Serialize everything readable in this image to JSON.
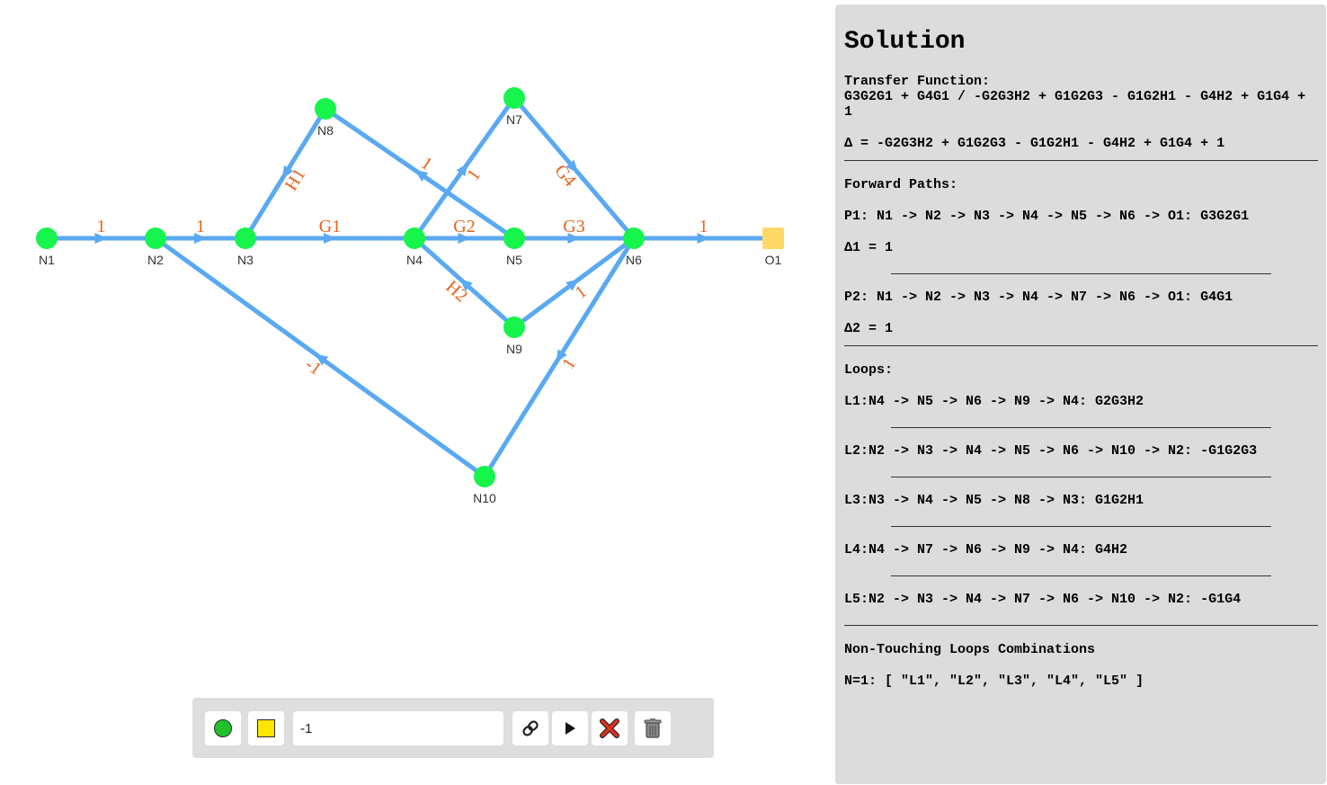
{
  "graph": {
    "nodes": [
      {
        "id": "N1",
        "label": "N1"
      },
      {
        "id": "N2",
        "label": "N2"
      },
      {
        "id": "N3",
        "label": "N3"
      },
      {
        "id": "N4",
        "label": "N4"
      },
      {
        "id": "N5",
        "label": "N5"
      },
      {
        "id": "N6",
        "label": "N6"
      },
      {
        "id": "N7",
        "label": "N7"
      },
      {
        "id": "N8",
        "label": "N8"
      },
      {
        "id": "N9",
        "label": "N9"
      },
      {
        "id": "N10",
        "label": "N10"
      },
      {
        "id": "O1",
        "label": "O1",
        "kind": "output"
      }
    ],
    "edges": [
      {
        "from": "N1",
        "to": "N2",
        "gain": "1"
      },
      {
        "from": "N2",
        "to": "N3",
        "gain": "1"
      },
      {
        "from": "N3",
        "to": "N4",
        "gain": "G1"
      },
      {
        "from": "N4",
        "to": "N5",
        "gain": "G2"
      },
      {
        "from": "N5",
        "to": "N6",
        "gain": "G3"
      },
      {
        "from": "N6",
        "to": "O1",
        "gain": "1"
      },
      {
        "from": "N8",
        "to": "N3",
        "gain": "H1"
      },
      {
        "from": "N5",
        "to": "N8",
        "gain": "1"
      },
      {
        "from": "N4",
        "to": "N7",
        "gain": "1"
      },
      {
        "from": "N7",
        "to": "N6",
        "gain": "G4"
      },
      {
        "from": "N9",
        "to": "N4",
        "gain": "H2"
      },
      {
        "from": "N9",
        "to": "N6",
        "gain": "1"
      },
      {
        "from": "N10",
        "to": "N2",
        "gain": "-1"
      },
      {
        "from": "N6",
        "to": "N10",
        "gain": "1"
      }
    ],
    "colors": {
      "node": "#17f54c",
      "edge": "#5aa9f2",
      "output": "#ffd966",
      "label": "#e8621a"
    }
  },
  "toolbar": {
    "add_node_icon": "green-circle-icon",
    "add_output_icon": "yellow-square-icon",
    "weight_value": "-1",
    "connect_icon": "link-icon",
    "run_icon": "play-icon",
    "delete_icon": "red-x-icon",
    "clear_icon": "trash-icon"
  },
  "solution": {
    "title": "Solution",
    "transfer_title": "Transfer Function:",
    "transfer_value": "G3G2G1 + G4G1 / -G2G3H2 + G1G2G3 - G1G2H1 - G4H2 + G1G4 + 1",
    "delta": "∆ = -G2G3H2 + G1G2G3 - G1G2H1 - G4H2 + G1G4 + 1",
    "forward_title": "Forward Paths:",
    "paths": [
      {
        "path": "P1: N1 -> N2 -> N3 -> N4 -> N5 -> N6 -> O1: G3G2G1",
        "delta": "∆1 = 1"
      },
      {
        "path": "P2: N1 -> N2 -> N3 -> N4 -> N7 -> N6 -> O1: G4G1",
        "delta": "∆2 = 1"
      }
    ],
    "loops_title": "Loops:",
    "loops": [
      "L1:N4 -> N5 -> N6 -> N9 -> N4: G2G3H2",
      "L2:N2 -> N3 -> N4 -> N5 -> N6 -> N10 -> N2: -G1G2G3",
      "L3:N3 -> N4 -> N5 -> N8 -> N3: G1G2H1",
      "L4:N4 -> N7 -> N6 -> N9 -> N4: G4H2",
      "L5:N2 -> N3 -> N4 -> N7 -> N6 -> N10 -> N2: -G1G4"
    ],
    "ntl_title": "Non-Touching Loops Combinations",
    "ntl_line": "N=1: [ \"L1\", \"L2\", \"L3\", \"L4\", \"L5\" ]"
  }
}
